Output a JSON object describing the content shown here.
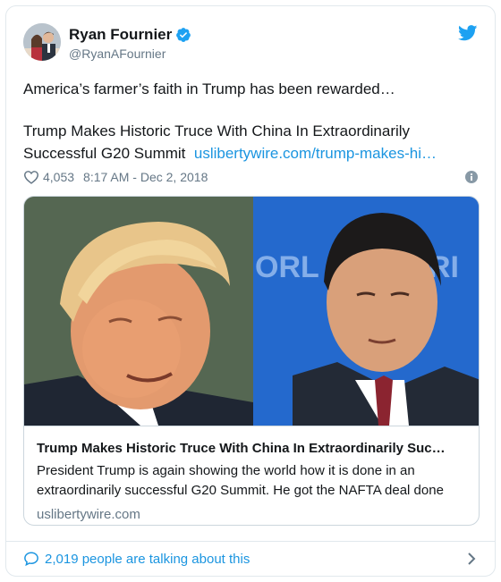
{
  "author": {
    "display_name": "Ryan Fournier",
    "handle": "@RyanAFournier",
    "verified": true
  },
  "tweet": {
    "line1": "America’s farmer’s faith in Trump has been rewarded…",
    "headline": "Trump Makes Historic Truce With China In Extraordinarily Successful G20 Summit",
    "link_text": "uslibertywire.com/trump-makes-hi…"
  },
  "meta": {
    "likes": "4,053",
    "timestamp": "8:17 AM - Dec 2, 2018"
  },
  "card": {
    "image_overlay_text": "ORL ONO ORI",
    "title": "Trump Makes Historic Truce With China In Extraordinarily Suc…",
    "description": "President Trump is again showing the world how it is done in an extraordinarily successful G20 Summit. He got the NAFTA deal done",
    "domain": "uslibertywire.com"
  },
  "footer": {
    "conversation": "2,019 people are talking about this"
  },
  "colors": {
    "link": "#1b95e0",
    "secondary_text": "#657786",
    "border": "#e1e8ed"
  },
  "icons": [
    "avatar",
    "verified-badge-icon",
    "twitter-bird-icon",
    "heart-icon",
    "info-icon",
    "speech-bubble-icon",
    "chevron-right-icon"
  ]
}
